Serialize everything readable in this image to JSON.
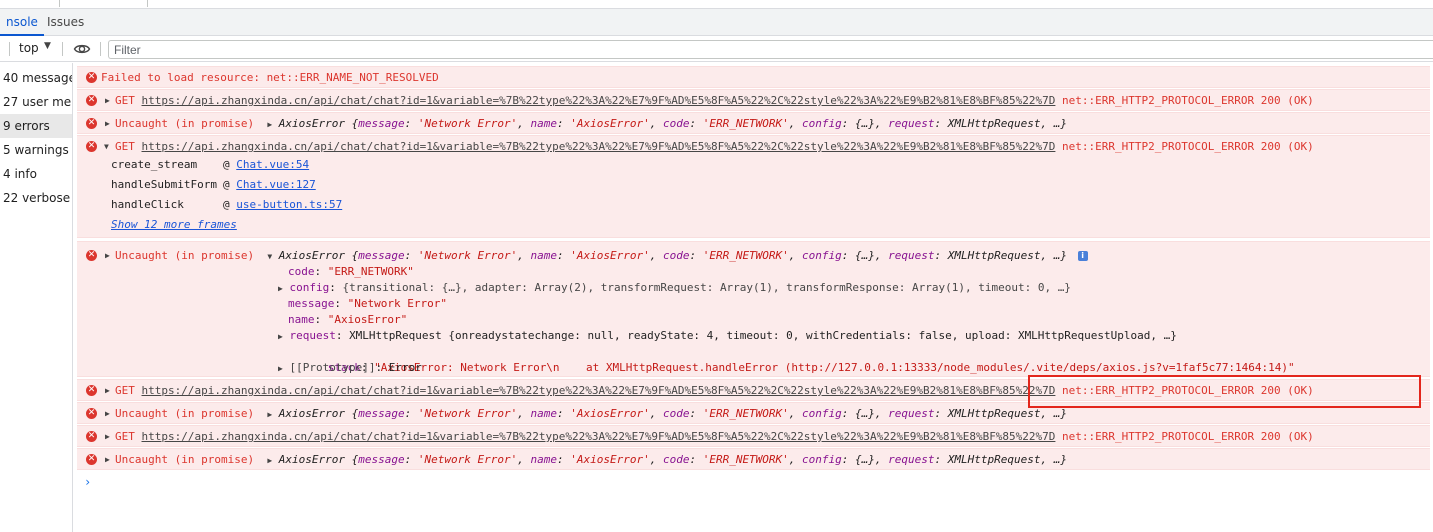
{
  "tabs": [
    {
      "label": "nsole"
    },
    {
      "label": "Issues"
    }
  ],
  "toolbar": {
    "context": "top",
    "filter_placeholder": "Filter"
  },
  "sidebar": {
    "items": [
      {
        "label": "40 messages"
      },
      {
        "label": "27 user me..."
      },
      {
        "label": "9 errors"
      },
      {
        "label": "5 warnings"
      },
      {
        "label": "4 info"
      },
      {
        "label": "22 verbose"
      }
    ]
  },
  "console": {
    "m1": {
      "text": "Failed to load resource: net::ERR_NAME_NOT_RESOLVED"
    },
    "get_url": "https://api.zhangxinda.cn/api/chat/chat?id=1&variable=%7B%22type%22%3A%22%E7%9F%AD%E5%8F%A5%22%2C%22style%22%3A%22%E9%B2%81%E8%BF%85%22%7D",
    "get_prefix": "GET",
    "get_error": "net::ERR_HTTP2_PROTOCOL_ERROR 200 (OK)",
    "uncaught": "Uncaught (in promise)",
    "axios_summary": {
      "p1": "AxiosError {",
      "k1": "message",
      "v1": "'Network Error'",
      "k2": "name",
      "v2": "'AxiosError'",
      "k3": "code",
      "v3": "'ERR_NETWORK'",
      "k4": "config",
      "v4": "{…}",
      "k5": "request",
      "v5": "XMLHttpRequest",
      "tail": ", …}"
    },
    "stack": [
      {
        "fn": "create_stream",
        "at": "@",
        "src": "Chat.vue:54"
      },
      {
        "fn": "handleSubmitForm",
        "at": "@",
        "src": "Chat.vue:127"
      },
      {
        "fn": "handleClick",
        "at": "@",
        "src": "use-button.ts:57"
      }
    ],
    "show_more": "Show 12 more frames",
    "expanded": {
      "code_key": "code",
      "code_val": "\"ERR_NETWORK\"",
      "config_key": "config",
      "config_val": "{transitional: {…}, adapter: Array(2), transformRequest: Array(1), transformResponse: Array(1), timeout: 0, …}",
      "message_key": "message",
      "message_val": "\"Network Error\"",
      "name_key": "name",
      "name_val": "\"AxiosError\"",
      "request_key": "request",
      "request_val": "XMLHttpRequest {onreadystatechange: null, readyState: 4, timeout: 0, withCredentials: false, upload: XMLHttpRequestUpload, …}",
      "stack_key": "stack",
      "stack_val": "\"AxiosError: Network Error\\n    at XMLHttpRequest.handleError (http://127.0.0.1:13333/node_modules/.vite/deps/axios.js?v=1faf5c77:1464:14)\"",
      "proto_key": "[[Prototype]]",
      "proto_val": "Error"
    },
    "info_badge": "i",
    "prompt": "›"
  },
  "colors": {
    "error_red": "#dc362e",
    "error_bg": "#fcebeb",
    "highlight_box": "#e3261c",
    "active_tab": "#0b57d0"
  }
}
